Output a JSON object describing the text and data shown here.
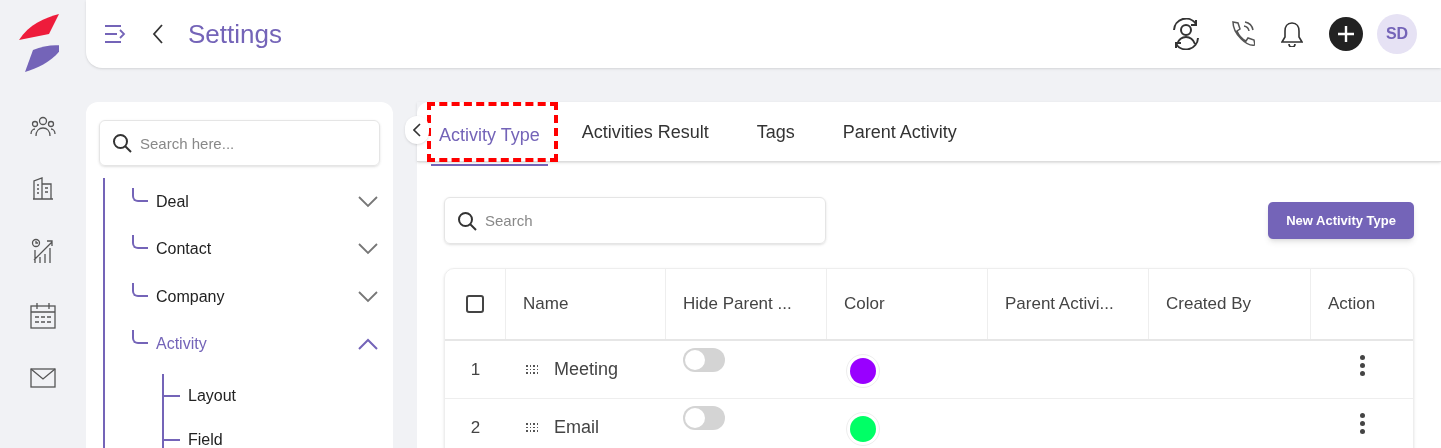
{
  "header": {
    "title": "Settings",
    "avatar_initials": "SD"
  },
  "settings_nav": {
    "search_placeholder": "Search here...",
    "items": [
      {
        "label": "Deal",
        "selected": false,
        "expanded": false
      },
      {
        "label": "Contact",
        "selected": false,
        "expanded": false
      },
      {
        "label": "Company",
        "selected": false,
        "expanded": false
      },
      {
        "label": "Activity",
        "selected": true,
        "expanded": true,
        "children": [
          {
            "label": "Layout"
          },
          {
            "label": "Field"
          }
        ]
      }
    ]
  },
  "tabs": [
    {
      "label": "Activity Type",
      "selected": true
    },
    {
      "label": "Activities Result",
      "selected": false
    },
    {
      "label": "Tags",
      "selected": false
    },
    {
      "label": "Parent Activity",
      "selected": false
    }
  ],
  "search": {
    "placeholder": "Search"
  },
  "new_button": "New Activity Type",
  "table": {
    "select_all_checked": false,
    "columns": [
      "Name",
      "Hide Parent ...",
      "Color",
      "Parent Activi...",
      "Created By",
      "Action"
    ],
    "rows": [
      {
        "index": "1",
        "name": "Meeting",
        "hide_parent": false,
        "color": "#9900ff"
      },
      {
        "index": "2",
        "name": "Email",
        "hide_parent": false,
        "color": "#00ff66"
      }
    ]
  }
}
